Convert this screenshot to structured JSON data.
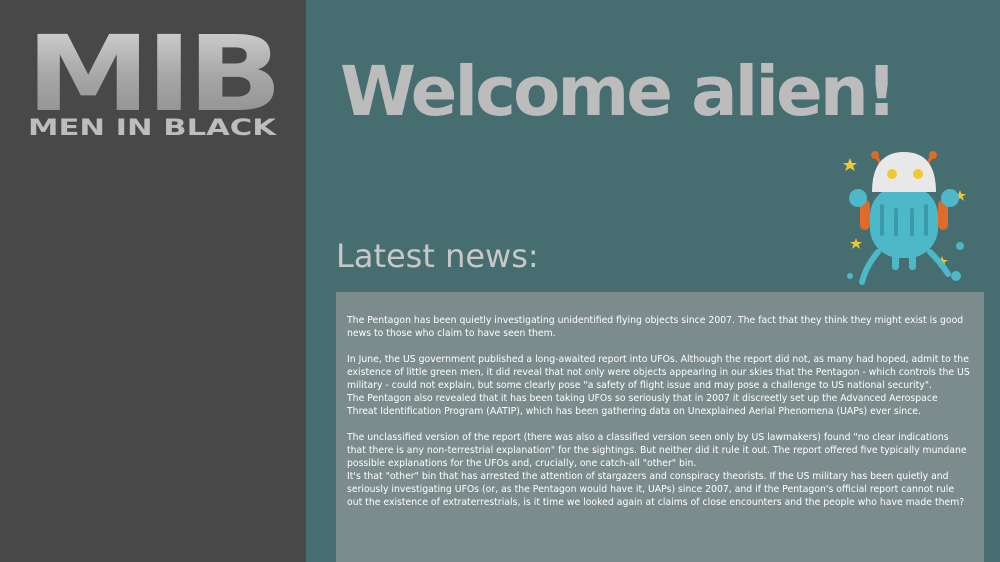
{
  "logo": {
    "letters": "MIB",
    "tagline": "MEN IN BLACK"
  },
  "colors": {
    "sidebar": "#484848",
    "page_background": "#466d70",
    "title": "#bcbcbc",
    "news_box": "#7c8c8d",
    "robot_body": "#4cb8c8",
    "robot_head": "#e8e8e8",
    "star": "#f0c830"
  },
  "main": {
    "title": "Welcome alien!",
    "news_heading": "Latest news:",
    "paragraphs": [
      "The Pentagon has been quietly investigating unidentified flying objects since 2007. The fact that they think they might exist is good news to those who claim to have seen them.",
      "In June, the US government published a long-awaited report into UFOs. Although the report did not, as many had hoped, admit to the existence of little green men, it did reveal that not only were objects appearing in our skies that the Pentagon - which controls the US military - could not explain, but some clearly pose \"a safety of flight issue and may pose a challenge to US national security\".",
      "The Pentagon also revealed that it has been taking UFOs so seriously that in 2007 it discreetly set up the Advanced Aerospace Threat Identification Program (AATIP), which has been gathering data on Unexplained Aerial Phenomena (UAPs) ever since.",
      "The unclassified version of the report (there was also a classified version seen only by US lawmakers) found \"no clear indications that there is any non-terrestrial explanation\" for the sightings. But neither did it rule it out. The report offered five typically mundane possible explanations for the UFOs and, crucially, one catch-all \"other\" bin.",
      "It's that \"other\" bin that has arrested the attention of stargazers and conspiracy theorists. If the US military has been quietly and seriously investigating UFOs (or, as the Pentagon would have it, UAPs) since 2007, and if the Pentagon's official report cannot rule out the existence of extraterrestrials, is it time we looked again at claims of close encounters and the people who have made them?"
    ]
  },
  "icons": {
    "robot": "alien-robot-icon",
    "logo": "mib-logo"
  }
}
